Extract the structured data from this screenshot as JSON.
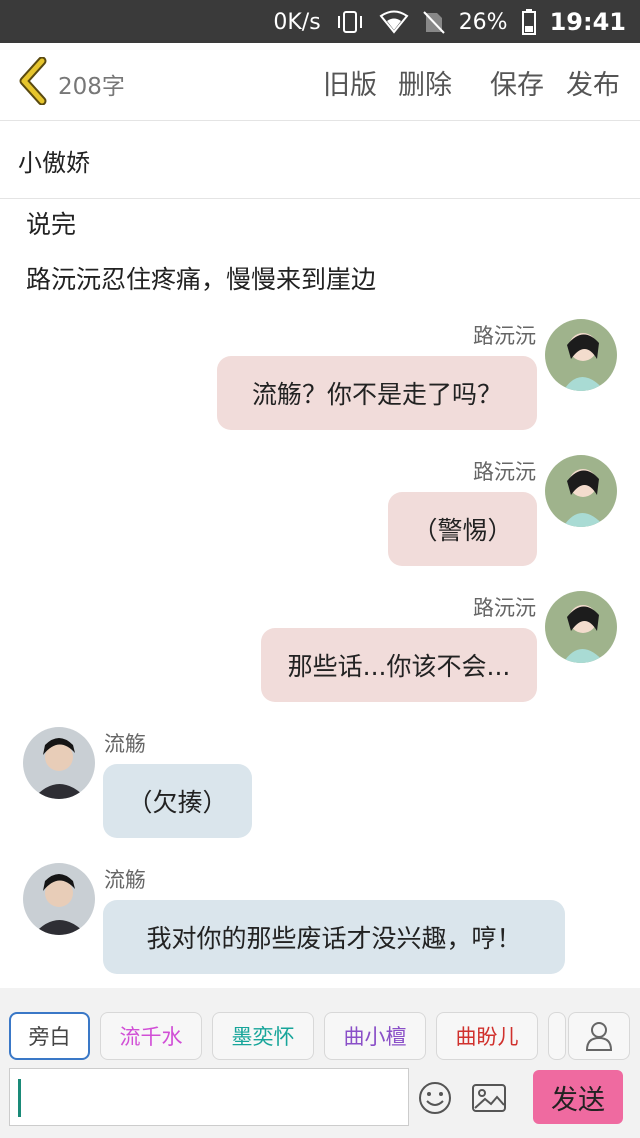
{
  "status_bar": {
    "speed": "0K/s",
    "battery": "26%",
    "time": "19:41"
  },
  "header": {
    "word_count": "208字",
    "old_version": "旧版",
    "delete": "删除",
    "save": "保存",
    "publish": "发布"
  },
  "title": "小傲娇",
  "narration": [
    "说完",
    "路沅沅忍住疼痛，慢慢来到崖边"
  ],
  "messages": [
    {
      "side": "right",
      "sender": "路沅沅",
      "text": "流觞？你不是走了吗？"
    },
    {
      "side": "right",
      "sender": "路沅沅",
      "text": "（警惕）"
    },
    {
      "side": "right",
      "sender": "路沅沅",
      "text": "那些话...你该不会..."
    },
    {
      "side": "left",
      "sender": "流觞",
      "text": "（欠揍）"
    },
    {
      "side": "left",
      "sender": "流觞",
      "text": "我对你的那些废话才没兴趣，哼！"
    }
  ],
  "role_chips": [
    {
      "label": "旁白",
      "color": "#444444"
    },
    {
      "label": "流千水",
      "color": "#d14fd6"
    },
    {
      "label": "墨奕怀",
      "color": "#17a59a"
    },
    {
      "label": "曲小檀",
      "color": "#8a4fc8"
    },
    {
      "label": "曲盼儿",
      "color": "#d0312d"
    }
  ],
  "composer": {
    "placeholder": "",
    "send": "发送"
  },
  "colors": {
    "right_bubble": "#f1dcda",
    "left_bubble": "#dae5ec",
    "send_button": "#ef6aa0",
    "back_arrow": "#e6c52d"
  },
  "icons": [
    "back-arrow-icon",
    "vibrate-icon",
    "wifi-icon",
    "no-sim-icon",
    "battery-icon",
    "user-icon",
    "emoji-icon",
    "image-icon"
  ]
}
